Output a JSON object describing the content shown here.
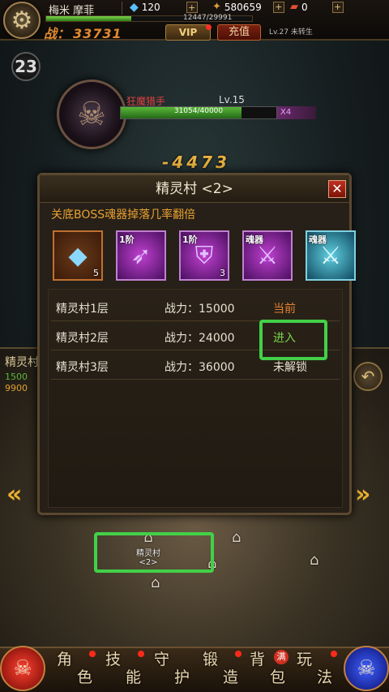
{
  "hud": {
    "player_name": "梅米 摩菲",
    "gems": "120",
    "gold": "580659",
    "tickets": "0",
    "exp_text": "12447/29991",
    "exp_ratio": 0.415,
    "power_label": "战：",
    "power_value": "33731",
    "vip_label": "VIP",
    "recharge_label": "充值",
    "level_text": "Lv.27 未转生",
    "mini_icon": "23"
  },
  "boss": {
    "name": "狂魔猎手",
    "level": "Lv.15",
    "hp_text": "31054/40000",
    "hp_ratio": 0.776,
    "multiplier": "X4",
    "damage": "-4473"
  },
  "map": {
    "side_title": "精灵村",
    "side_line1": "1500",
    "side_line2": "9900",
    "node_main_label": "精灵村",
    "node_main_sub": "<2>",
    "back_icon": "back-arrow-icon"
  },
  "dialog": {
    "title": "精灵村 <2>",
    "close_label": "✕",
    "subtitle": "关底BOSS魂器掉落几率翻倍",
    "rewards": [
      {
        "tag": "",
        "count": "5",
        "icon": "diamond-icon"
      },
      {
        "tag": "1阶",
        "count": "",
        "icon": "bow-icon"
      },
      {
        "tag": "1阶",
        "count": "3",
        "icon": "armor-icon"
      },
      {
        "tag": "魂器",
        "count": "",
        "icon": "crossed-swords-icon"
      },
      {
        "tag": "魂器",
        "count": "",
        "icon": "crossed-blades-icon"
      }
    ],
    "levels": [
      {
        "name": "精灵村1层",
        "power": "战力：15000",
        "status": "当前"
      },
      {
        "name": "精灵村2层",
        "power": "战力：24000",
        "status": "进入"
      },
      {
        "name": "精灵村3层",
        "power": "战力：36000",
        "status": "未解锁"
      }
    ]
  },
  "nav": {
    "items": [
      {
        "c1": "角",
        "c2": "色"
      },
      {
        "c1": "技",
        "c2": "能"
      },
      {
        "c1": "守",
        "c2": "护"
      },
      {
        "c1": "锻",
        "c2": "造"
      },
      {
        "c1": "背",
        "c2": "包"
      },
      {
        "c1": "玩",
        "c2": "法"
      }
    ],
    "full_badge": "满"
  },
  "colors": {
    "highlight": "#42d048",
    "accent_gold": "#e8a030",
    "status_current": "#e08030",
    "status_enter": "#7ad44a"
  }
}
